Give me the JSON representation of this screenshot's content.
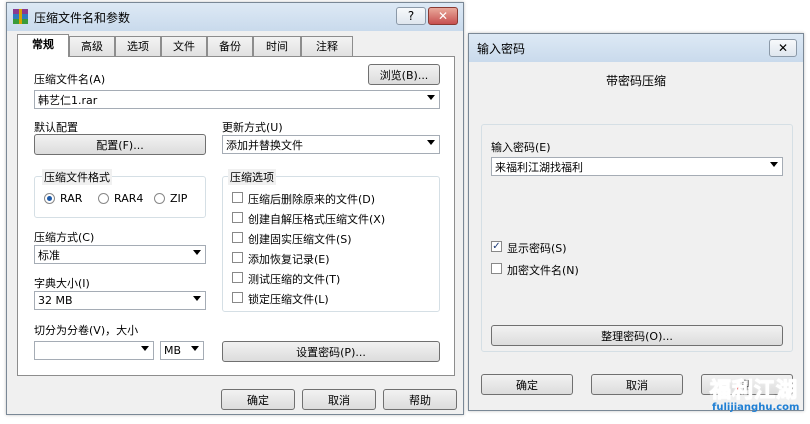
{
  "main_window": {
    "title": "压缩文件名和参数",
    "help_btn": "?",
    "close_btn": "✕",
    "tabs": [
      "常规",
      "高级",
      "选项",
      "文件",
      "备份",
      "时间",
      "注释"
    ],
    "archive_name_label": "压缩文件名(A)",
    "browse_btn": "浏览(B)...",
    "archive_name_value": "韩艺仁1.rar",
    "default_profile_label": "默认配置",
    "profiles_btn": "配置(F)...",
    "update_mode_label": "更新方式(U)",
    "update_mode_value": "添加并替换文件",
    "format_group_label": "压缩文件格式",
    "formats": [
      "RAR",
      "RAR4",
      "ZIP"
    ],
    "selected_format": "RAR",
    "options_group_label": "压缩选项",
    "options": [
      {
        "label": "压缩后删除原来的文件(D)",
        "checked": false
      },
      {
        "label": "创建自解压格式压缩文件(X)",
        "checked": false
      },
      {
        "label": "创建固实压缩文件(S)",
        "checked": false
      },
      {
        "label": "添加恢复记录(E)",
        "checked": false
      },
      {
        "label": "测试压缩的文件(T)",
        "checked": false
      },
      {
        "label": "锁定压缩文件(L)",
        "checked": false
      }
    ],
    "method_label": "压缩方式(C)",
    "method_value": "标准",
    "dict_label": "字典大小(I)",
    "dict_value": "32 MB",
    "split_label": "切分为分卷(V)，大小",
    "split_value": "",
    "split_unit": "MB",
    "set_password_btn": "设置密码(P)...",
    "ok_btn": "确定",
    "cancel_btn": "取消",
    "help_button": "帮助"
  },
  "password_dialog": {
    "title": "输入密码",
    "close_btn": "✕",
    "heading": "带密码压缩",
    "enter_label": "输入密码(E)",
    "password_value": "来福利江湖找福利",
    "show_password_label": "显示密码(S)",
    "show_password_checked": true,
    "encrypt_names_label": "加密文件名(N)",
    "encrypt_names_checked": false,
    "organize_btn": "整理密码(O)...",
    "ok_btn": "确定",
    "cancel_btn": "取消",
    "help_btn": "帮"
  },
  "watermark": {
    "text_cn": "福利江湖",
    "text_url": "fulijianghu.com",
    "colors": {
      "red": "#e8262a",
      "blue": "#1f7fd4"
    }
  },
  "colors": {
    "titlebar": "#c9daec",
    "accent": "#1e5aa8"
  }
}
